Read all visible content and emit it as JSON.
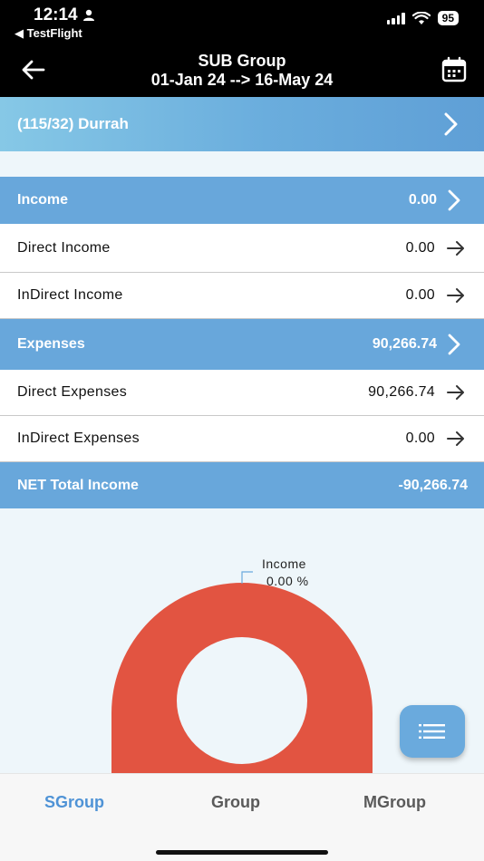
{
  "status": {
    "time": "12:14",
    "back_app": "◀ TestFlight",
    "battery": "95"
  },
  "header": {
    "title": "SUB Group",
    "subtitle": "01-Jan 24 --> 16-May 24"
  },
  "group": {
    "name": "(115/32) Durrah"
  },
  "sections": {
    "income": {
      "label": "Income",
      "value": "0.00",
      "items": [
        {
          "label": "Direct Income",
          "value": "0.00"
        },
        {
          "label": "InDirect Income",
          "value": "0.00"
        }
      ]
    },
    "expenses": {
      "label": "Expenses",
      "value": "90,266.74",
      "items": [
        {
          "label": "Direct Expenses",
          "value": "90,266.74"
        },
        {
          "label": "InDirect Expenses",
          "value": "0.00"
        }
      ]
    },
    "net": {
      "label": "NET Total Income",
      "value": "-90,266.74"
    }
  },
  "chart_data": {
    "type": "pie",
    "slices": [
      {
        "label": "Income",
        "display": "0.00 %",
        "value": 0.0
      }
    ],
    "color": "#e25441"
  },
  "tabs": [
    "SGroup",
    "Group",
    "MGroup"
  ],
  "colors": {
    "accent": "#68a7db",
    "chart": "#e25441",
    "active_tab": "#4f93d6"
  }
}
